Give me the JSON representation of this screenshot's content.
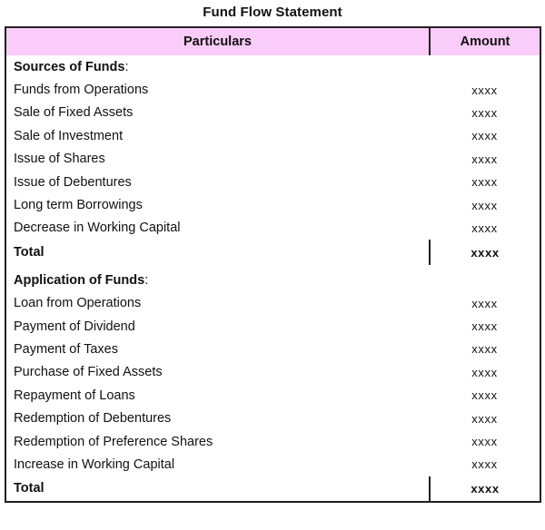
{
  "document": {
    "title": "Fund Flow Statement"
  },
  "table": {
    "columns": [
      {
        "key": "particulars",
        "label": "Particulars"
      },
      {
        "key": "amount",
        "label": "Amount"
      }
    ],
    "colors": {
      "header_background": "#F9CCF9",
      "border": "#231F20",
      "text": "#111111",
      "page_background": "#FFFFFF"
    },
    "amount_placeholder": "xxxx",
    "sections": [
      {
        "heading": {
          "text": "Sources of Funds",
          "colon": ":",
          "amount": ""
        },
        "rows": [
          {
            "particulars": "Funds from Operations",
            "amount": "xxxx"
          },
          {
            "particulars": "Sale of Fixed Assets",
            "amount": "xxxx"
          },
          {
            "particulars": "Sale of Investment",
            "amount": "xxxx"
          },
          {
            "particulars": "Issue of Shares",
            "amount": "xxxx"
          },
          {
            "particulars": "Issue of Debentures",
            "amount": "xxxx"
          },
          {
            "particulars": "Long term Borrowings",
            "amount": "xxxx"
          },
          {
            "particulars": "Decrease in Working Capital",
            "amount": "xxxx"
          }
        ],
        "total": {
          "particulars": "Total",
          "amount": "xxxx"
        }
      },
      {
        "heading": {
          "text": "Application of Funds",
          "colon": ":",
          "amount": ""
        },
        "rows": [
          {
            "particulars": "Loan from Operations",
            "amount": "xxxx"
          },
          {
            "particulars": "Payment of Dividend",
            "amount": "xxxx"
          },
          {
            "particulars": "Payment of Taxes",
            "amount": "xxxx"
          },
          {
            "particulars": "Purchase of Fixed Assets",
            "amount": "xxxx"
          },
          {
            "particulars": "Repayment of Loans",
            "amount": "xxxx"
          },
          {
            "particulars": "Redemption of Debentures",
            "amount": "xxxx"
          },
          {
            "particulars": "Redemption of Preference Shares",
            "amount": "xxxx"
          },
          {
            "particulars": "Increase in Working Capital",
            "amount": "xxxx"
          }
        ],
        "total": {
          "particulars": "Total",
          "amount": "xxxx"
        }
      }
    ]
  }
}
